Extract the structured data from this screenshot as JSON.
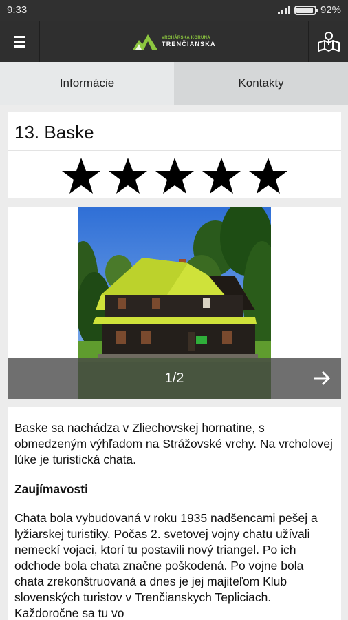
{
  "status_bar": {
    "time": "9:33",
    "battery": "92%"
  },
  "app_bar": {
    "logo_small": "VRCHÁRSKA KORUNA",
    "logo_big": "TRENČIANSKA",
    "menu_icon": "hamburger-menu-icon",
    "map_icon": "map-pin-icon"
  },
  "tabs": [
    {
      "label": "Informácie",
      "active": true
    },
    {
      "label": "Kontakty",
      "active": false
    }
  ],
  "place": {
    "title": "13. Baske",
    "rating": 5,
    "rating_max": 5
  },
  "gallery": {
    "counter": "1/2",
    "next_icon": "arrow-right-icon"
  },
  "description": {
    "intro": "Baske sa nachádza v Zliechovskej hornatine, s obmedzeným výhľadom na Strážovské vrchy. Na vrcholovej lúke je turistická chata.",
    "section_title": "Zaujímavosti",
    "section_text": "Chata bola vybudovaná v roku 1935 nadšencami pešej a lyžiarskej turistiky. Počas 2. svetovej vojny chatu užívali nemeckí vojaci, ktorí tu postavili nový triangel. Po ich odchode bola chata značne poškodená. Po vojne bola chata zrekonštruovaná a dnes je jej majiteľom Klub slovenských turistov v Trenčianskych Tepliciach. Každoročne sa tu vo"
  },
  "colors": {
    "app_bar": "#2f2f2f",
    "accent_green": "#8cc63f",
    "tab_active": "#e7e9ea",
    "tab_inactive": "#d5d7d8"
  }
}
